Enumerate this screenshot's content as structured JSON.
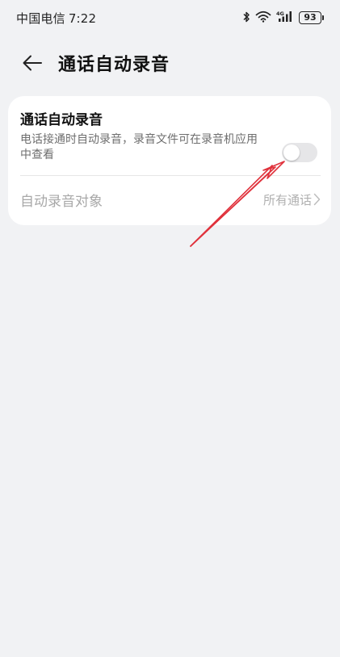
{
  "status_bar": {
    "carrier": "中国电信",
    "time": "7:22",
    "network": "4G",
    "battery": "93",
    "icons": [
      "bluetooth-icon",
      "wifi-icon",
      "signal-icon",
      "battery-icon"
    ]
  },
  "header": {
    "back_icon": "arrow-left-icon",
    "title": "通话自动录音"
  },
  "settings": {
    "auto_record": {
      "title": "通话自动录音",
      "description": "电话接通时自动录音，录音文件可在录音机应用中查看",
      "enabled": false
    },
    "record_target": {
      "label": "自动录音对象",
      "value": "所有通话"
    }
  },
  "colors": {
    "background": "#f1f2f4",
    "card": "#ffffff",
    "toggle_off": "#e6e6e8",
    "annotation_arrow": "#e0323c"
  }
}
